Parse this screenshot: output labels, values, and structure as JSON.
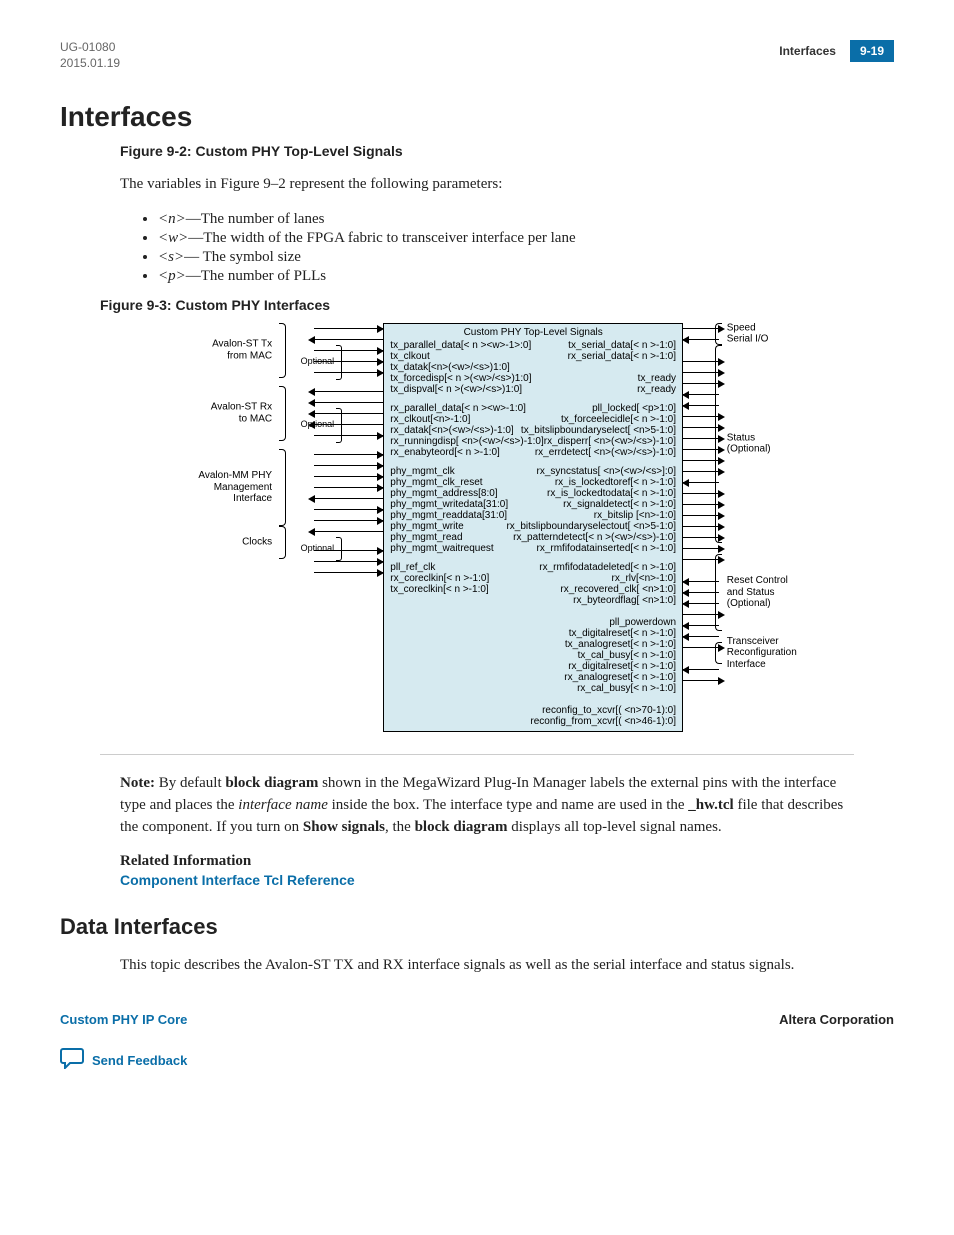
{
  "header": {
    "doc_id": "UG-01080",
    "date": "2015.01.19",
    "section": "Interfaces",
    "page": "9-19"
  },
  "h1": "Interfaces",
  "fig92": "Figure 9-2: Custom PHY Top-Level Signals",
  "intro": "The variables in Figure 9–2 represent the following parameters:",
  "params": [
    {
      "sym": "<n>",
      "desc": "—The number of lanes"
    },
    {
      "sym": "<w>",
      "desc": "—The width of the FPGA fabric to transceiver interface per lane"
    },
    {
      "sym": "<s>",
      "desc": "— The symbol size"
    },
    {
      "sym": "<p>",
      "desc": "—The number of PLLs"
    }
  ],
  "fig93": "Figure 9-3: Custom PHY Interfaces",
  "diagram": {
    "box_title": "Custom PHY Top-Level Signals",
    "optional_label": "Optional",
    "left_groups": [
      {
        "label": "Avalon-ST Tx\nfrom MAC",
        "rows": 5,
        "optional_start": 2,
        "optional_count": 3
      },
      {
        "label": "Avalon-ST Rx\nto MAC",
        "rows": 5,
        "optional_start": 2,
        "optional_count": 3
      },
      {
        "label": "Avalon-MM PHY\nManagement\nInterface",
        "rows": 7,
        "optional_start": -1,
        "optional_count": 0
      },
      {
        "label": "Clocks",
        "rows": 3,
        "optional_start": 1,
        "optional_count": 2
      }
    ],
    "right_groups": [
      {
        "label": "Speed\nSerial I/O",
        "rows": 2,
        "offset": 0
      },
      {
        "label": "Status\n(Optional)",
        "rows": 18,
        "offset": 2
      },
      {
        "label": "Reset Control\nand Status\n(Optional)",
        "rows": 7,
        "offset": 21
      },
      {
        "label": "Transceiver\nReconfiguration\nInterface",
        "rows": 2,
        "offset": 29
      }
    ],
    "left_col": [
      {
        "t": "tx_parallel_data[< n ><w>-1>:0]",
        "d": "in"
      },
      {
        "t": "tx_clkout",
        "d": "out"
      },
      {
        "t": "tx_datak[<n>(<w>/<s>)1:0]",
        "d": "in"
      },
      {
        "t": "tx_forcedisp[< n >(<w>/<s>)1:0]",
        "d": "in"
      },
      {
        "t": "tx_dispval[< n >(<w>/<s>)1:0]",
        "d": "in"
      },
      {
        "t": "rx_parallel_data[< n ><w>-1:0]",
        "d": "out"
      },
      {
        "t": "rx_clkout[<n>-1:0]",
        "d": "out"
      },
      {
        "t": "rx_datak[<n>(<w>/<s>)-1:0]",
        "d": "out"
      },
      {
        "t": "rx_runningdisp[ <n>(<w>/<s>)-1:0]",
        "d": "out"
      },
      {
        "t": "rx_enabyteord[< n >-1:0]",
        "d": "in"
      },
      {
        "t": "phy_mgmt_clk",
        "d": "in"
      },
      {
        "t": "phy_mgmt_clk_reset",
        "d": "in"
      },
      {
        "t": "phy_mgmt_address[8:0]",
        "d": "in"
      },
      {
        "t": "phy_mgmt_writedata[31:0]",
        "d": "in"
      },
      {
        "t": "phy_mgmt_readdata[31:0]",
        "d": "out"
      },
      {
        "t": "phy_mgmt_write",
        "d": "in"
      },
      {
        "t": "phy_mgmt_read",
        "d": "in"
      },
      {
        "t": "phy_mgmt_waitrequest",
        "d": "out"
      },
      {
        "t": "pll_ref_clk",
        "d": "in"
      },
      {
        "t": "rx_coreclkin[< n >-1:0]",
        "d": "in"
      },
      {
        "t": "tx_coreclkin[< n >-1:0]",
        "d": "in"
      }
    ],
    "right_col": [
      {
        "t": "tx_serial_data[< n >-1:0]",
        "d": "out"
      },
      {
        "t": "rx_serial_data[< n >-1:0]",
        "d": "in"
      },
      {
        "t": "",
        "d": ""
      },
      {
        "t": "tx_ready",
        "d": "out"
      },
      {
        "t": "rx_ready",
        "d": "out"
      },
      {
        "t": "pll_locked[ <p>1:0]",
        "d": "out"
      },
      {
        "t": "tx_forceelecidle[< n >-1:0]",
        "d": "in"
      },
      {
        "t": "tx_bitslipboundaryselect[  <n>5-1:0]",
        "d": "in"
      },
      {
        "t": "rx_disperr[ <n>(<w>/<s>)-1:0]",
        "d": "out"
      },
      {
        "t": "rx_errdetect[ <n>(<w>/<s>)-1:0]",
        "d": "out"
      },
      {
        "t": "rx_syncstatus[ <n>(<w>/<s>]:0]",
        "d": "out"
      },
      {
        "t": "rx_is_lockedtoref[< n >-1:0]",
        "d": "out"
      },
      {
        "t": "rx_is_lockedtodata[< n >-1:0]",
        "d": "out"
      },
      {
        "t": "rx_signaldetect[< n >-1:0]",
        "d": "out"
      },
      {
        "t": "rx_bitslip [<n>-1:0]",
        "d": "in"
      },
      {
        "t": "rx_bitslipboundaryselectout[  <n>5-1:0]",
        "d": "out"
      },
      {
        "t": "rx_patterndetect[< n >(<w>/<s>)-1:0]",
        "d": "out"
      },
      {
        "t": "rx_rmfifodatainserted[< n >-1:0]",
        "d": "out"
      },
      {
        "t": "rx_rmfifodatadeleted[< n >-1:0]",
        "d": "out"
      },
      {
        "t": "rx_rlv[<n>-1:0]",
        "d": "out"
      },
      {
        "t": "rx_recovered_clk[ <n>1:0]",
        "d": "out"
      },
      {
        "t": "rx_byteordflag[ <n>1:0]",
        "d": "out"
      },
      {
        "t": "",
        "d": ""
      },
      {
        "t": "pll_powerdown",
        "d": "in"
      },
      {
        "t": "tx_digitalreset[< n >-1:0]",
        "d": "in"
      },
      {
        "t": "tx_analogreset[< n >-1:0]",
        "d": "in"
      },
      {
        "t": "tx_cal_busy[< n >-1:0]",
        "d": "out"
      },
      {
        "t": "rx_digitalreset[< n >-1:0]",
        "d": "in"
      },
      {
        "t": "rx_analogreset[< n >-1:0]",
        "d": "in"
      },
      {
        "t": "rx_cal_busy[< n >-1:0]",
        "d": "out"
      },
      {
        "t": "",
        "d": ""
      },
      {
        "t": "reconfig_to_xcvr[(  <n>70-1):0]",
        "d": "in"
      },
      {
        "t": "reconfig_from_xcvr[(  <n>46-1):0]",
        "d": "out"
      }
    ]
  },
  "note": {
    "label": "Note:",
    "pre": "By default ",
    "bold1": "block diagram",
    "mid1": " shown in the MegaWizard Plug-In Manager labels the external pins with the interface type and places the ",
    "ital1": "interface name",
    "mid2": " inside the box. The interface type and name are used in the ",
    "bold2": "_hw.tcl",
    "mid3": " file that describes the component. If you turn on ",
    "bold3": "Show signals",
    "mid4": ", the ",
    "bold4": "block diagram",
    "end": " displays all top-level signal names."
  },
  "related_h": "Related Information",
  "related_link": "Component Interface Tcl Reference",
  "h2": "Data Interfaces",
  "h2_body": "This topic describes the Avalon-ST TX and RX interface signals as well as the serial interface and status signals.",
  "footer": {
    "left": "Custom PHY IP Core",
    "right": "Altera Corporation",
    "feedback": "Send Feedback"
  }
}
